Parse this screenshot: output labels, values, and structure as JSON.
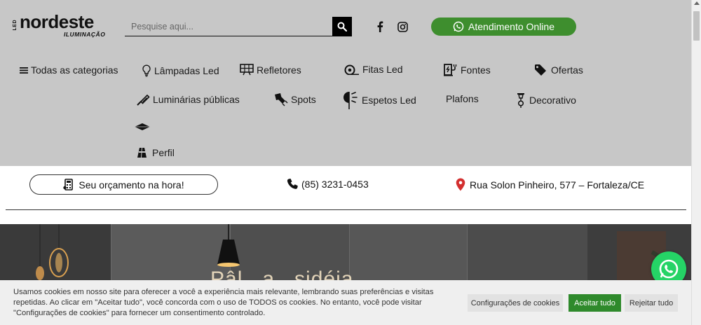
{
  "logo": {
    "led": "LED",
    "brand": "nordeste",
    "sub": "ILUMINAÇÃO"
  },
  "search": {
    "placeholder": "Pesquise aqui..."
  },
  "social": [
    "facebook-icon",
    "instagram-icon"
  ],
  "atendimento": {
    "label": "Atendimento Online",
    "color": "#3e8e2e"
  },
  "menu": {
    "all_categories": "Todas as categorias",
    "items": [
      {
        "label": "Lâmpadas Led",
        "icon": "bulb-icon"
      },
      {
        "label": "Refletores",
        "icon": "reflector-icon"
      },
      {
        "label": "Fitas Led",
        "icon": "led-strip-icon"
      },
      {
        "label": "Fontes",
        "icon": "power-supply-icon"
      },
      {
        "label": "Ofertas",
        "icon": "tag-icon"
      },
      {
        "label": "Luminárias públicas",
        "icon": "street-lamp-icon"
      },
      {
        "label": "Spots",
        "icon": "spot-icon"
      },
      {
        "label": "Espetos Led",
        "icon": "garden-spike-icon"
      },
      {
        "label": "Plafons",
        "icon": ""
      },
      {
        "label": "Decorativo",
        "icon": "decor-lamp-icon"
      },
      {
        "label": "",
        "icon": "diamond-plafon-icon"
      },
      {
        "label": "Perfil",
        "icon": "profile-icon"
      }
    ]
  },
  "contact": {
    "quote_button": "Seu orçamento na hora!",
    "phone": "(85) 3231-0453",
    "address": "Rua Solon Pinheiro, 577 – Fortaleza/CE"
  },
  "hero": {
    "heading": "Pâl...a...sidéia"
  },
  "cookie": {
    "text": "Usamos cookies em nosso site para oferecer a você a experiência mais relevante, lembrando suas preferências e visitas repetidas. Ao clicar em \"Aceitar tudo\", você concorda com o uso de TODOS os cookies. No entanto, você pode visitar \"Configurações de cookies\" para fornecer um consentimento controlado.",
    "settings_button": "Configurações de cookies",
    "accept_button": "Aceitar tudo",
    "reject_button": "Rejeitar tudo",
    "accept_color": "#2f8a2c"
  }
}
